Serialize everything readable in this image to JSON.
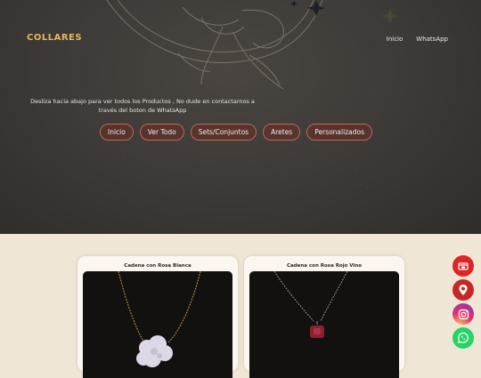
{
  "header": {
    "brand": "COLLARES",
    "nav": [
      "Inicio",
      "WhatsApp"
    ]
  },
  "hero": {
    "tagline": "Desliza hacia abajo para ver todos los Productos , No dude en contactarnos a través del boton de WhatsApp",
    "categories": [
      "Inicio",
      "Ver Todo",
      "Sets/Conjuntos",
      "Aretes",
      "Personalizados"
    ]
  },
  "products": [
    {
      "name": "Cadena con Rosa Blanca"
    },
    {
      "name": "Cadena con Rosa Rojo Vino"
    }
  ],
  "floating_buttons": [
    {
      "icon": "store-icon",
      "color": "#e02424"
    },
    {
      "icon": "location-pin-icon",
      "color": "#c62828"
    },
    {
      "icon": "instagram-icon",
      "color": "#c13584"
    },
    {
      "icon": "whatsapp-icon",
      "color": "#25d366"
    }
  ],
  "colors": {
    "brand_gold": "#e4b95b",
    "pill_border": "#b86a58",
    "page_background": "#efe6d5"
  }
}
